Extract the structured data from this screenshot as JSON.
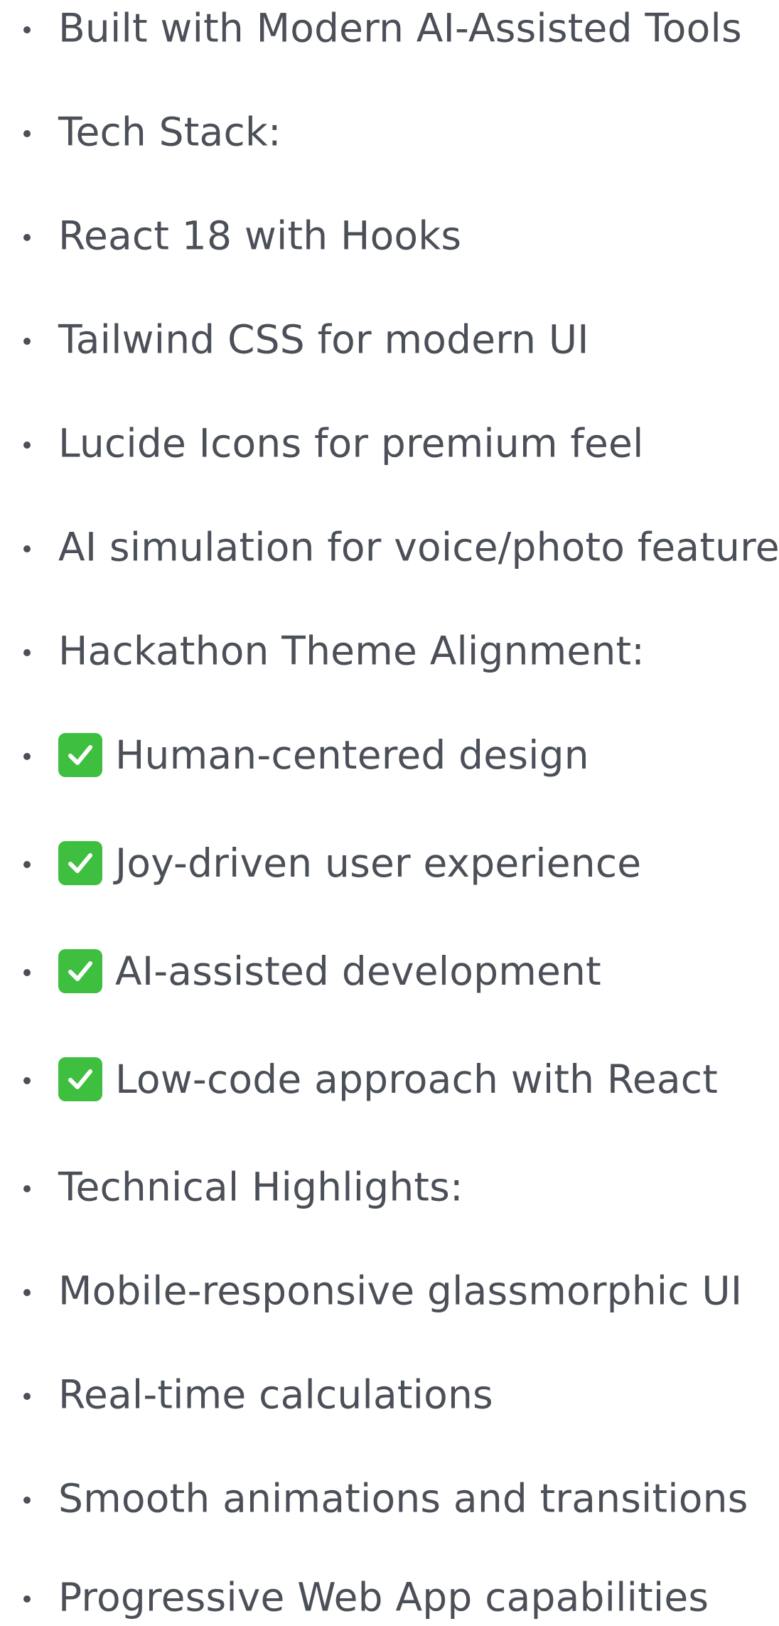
{
  "items": [
    {
      "label": "Built with Modern AI-Assisted Tools",
      "checked": false
    },
    {
      "label": "Tech Stack:",
      "checked": false
    },
    {
      "label": "React 18 with Hooks",
      "checked": false
    },
    {
      "label": "Tailwind CSS for modern UI",
      "checked": false
    },
    {
      "label": "Lucide Icons for premium feel",
      "checked": false
    },
    {
      "label": "AI simulation for voice/photo features",
      "checked": false
    },
    {
      "label": "Hackathon Theme Alignment:",
      "checked": false
    },
    {
      "label": "Human-centered design",
      "checked": true
    },
    {
      "label": "Joy-driven user experience",
      "checked": true
    },
    {
      "label": "AI-assisted development",
      "checked": true
    },
    {
      "label": "Low-code approach with React",
      "checked": true
    },
    {
      "label": "Technical Highlights:",
      "checked": false
    },
    {
      "label": "Mobile-responsive glassmorphic UI",
      "checked": false
    },
    {
      "label": "Real-time calculations",
      "checked": false
    },
    {
      "label": "Smooth animations and transitions",
      "checked": false
    },
    {
      "label": "Progressive Web App capabilities",
      "checked": false
    }
  ],
  "colors": {
    "text": "#4b4f58",
    "check_bg": "#3fbf3f",
    "check_mark": "#ffffff"
  },
  "icons": {
    "check": "check-mark-button-icon"
  }
}
